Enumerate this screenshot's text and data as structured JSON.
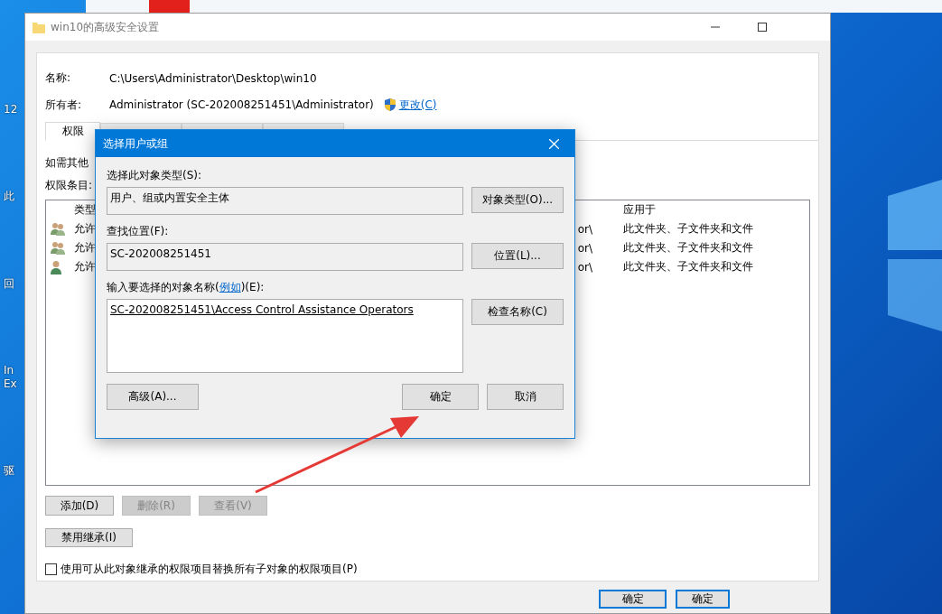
{
  "desktop_icons": [
    {
      "label": "12"
    },
    {
      "label": "此"
    },
    {
      "label": "回"
    },
    {
      "label": "In Ex"
    },
    {
      "label": "驱"
    }
  ],
  "window": {
    "title": "win10的高级安全设置",
    "fields": [
      {
        "label": "名称:",
        "value": "C:\\Users\\Administrator\\Desktop\\win10"
      },
      {
        "label": "所有者:",
        "value": "Administrator (SC-202008251451\\Administrator)",
        "link": "更改(C)"
      }
    ],
    "tabs": [
      {
        "label": "权限",
        "selected": true
      },
      {
        "selected": false
      },
      {
        "selected": false
      },
      {
        "selected": false
      }
    ],
    "hint": "如需其他",
    "entries_label": "权限条目:",
    "table": {
      "columns": [
        {
          "label": "类型"
        },
        {
          "label": "应用于"
        }
      ],
      "rows": [
        {
          "kind": "group",
          "type": "允许",
          "column_3": "or\\",
          "applies_to": "此文件夹、子文件夹和文件"
        },
        {
          "kind": "group",
          "type": "允许",
          "column_3": "or\\",
          "applies_to": "此文件夹、子文件夹和文件"
        },
        {
          "kind": "user",
          "type": "允许",
          "column_3": "or\\",
          "applies_to": "此文件夹、子文件夹和文件"
        }
      ]
    },
    "entry_buttons": [
      {
        "label": "添加(D)",
        "disabled": false
      },
      {
        "label": "删除(R)",
        "disabled": true
      },
      {
        "label": "查看(V)",
        "disabled": true
      }
    ],
    "inherit_button": "禁用继承(I)",
    "replace_checkbox": {
      "label": "使用可从此对象继承的权限项目替换所有子对象的权限项目(P)",
      "checked": false
    },
    "footer_buttons": [
      {
        "label": "确定",
        "focused": true
      },
      {
        "label": "确定",
        "focused": true
      }
    ]
  },
  "dialog": {
    "title": "选择用户或组",
    "object_type": {
      "label": "选择此对象类型(S):",
      "value": "用户、组或内置安全主体",
      "button": "对象类型(O)..."
    },
    "location": {
      "label": "查找位置(F):",
      "value": "SC-202008251451",
      "button": "位置(L)..."
    },
    "names": {
      "label_prefix": "输入要选择的对象名称(",
      "example_link": "例如",
      "label_suffix": ")(E):",
      "value": "SC-202008251451\\Access Control Assistance Operators",
      "button": "检查名称(C)"
    },
    "buttons": [
      {
        "label": "高级(A)...",
        "kind": "left"
      },
      {
        "label": "确定",
        "kind": "right"
      },
      {
        "label": "取消",
        "kind": "right"
      }
    ]
  }
}
